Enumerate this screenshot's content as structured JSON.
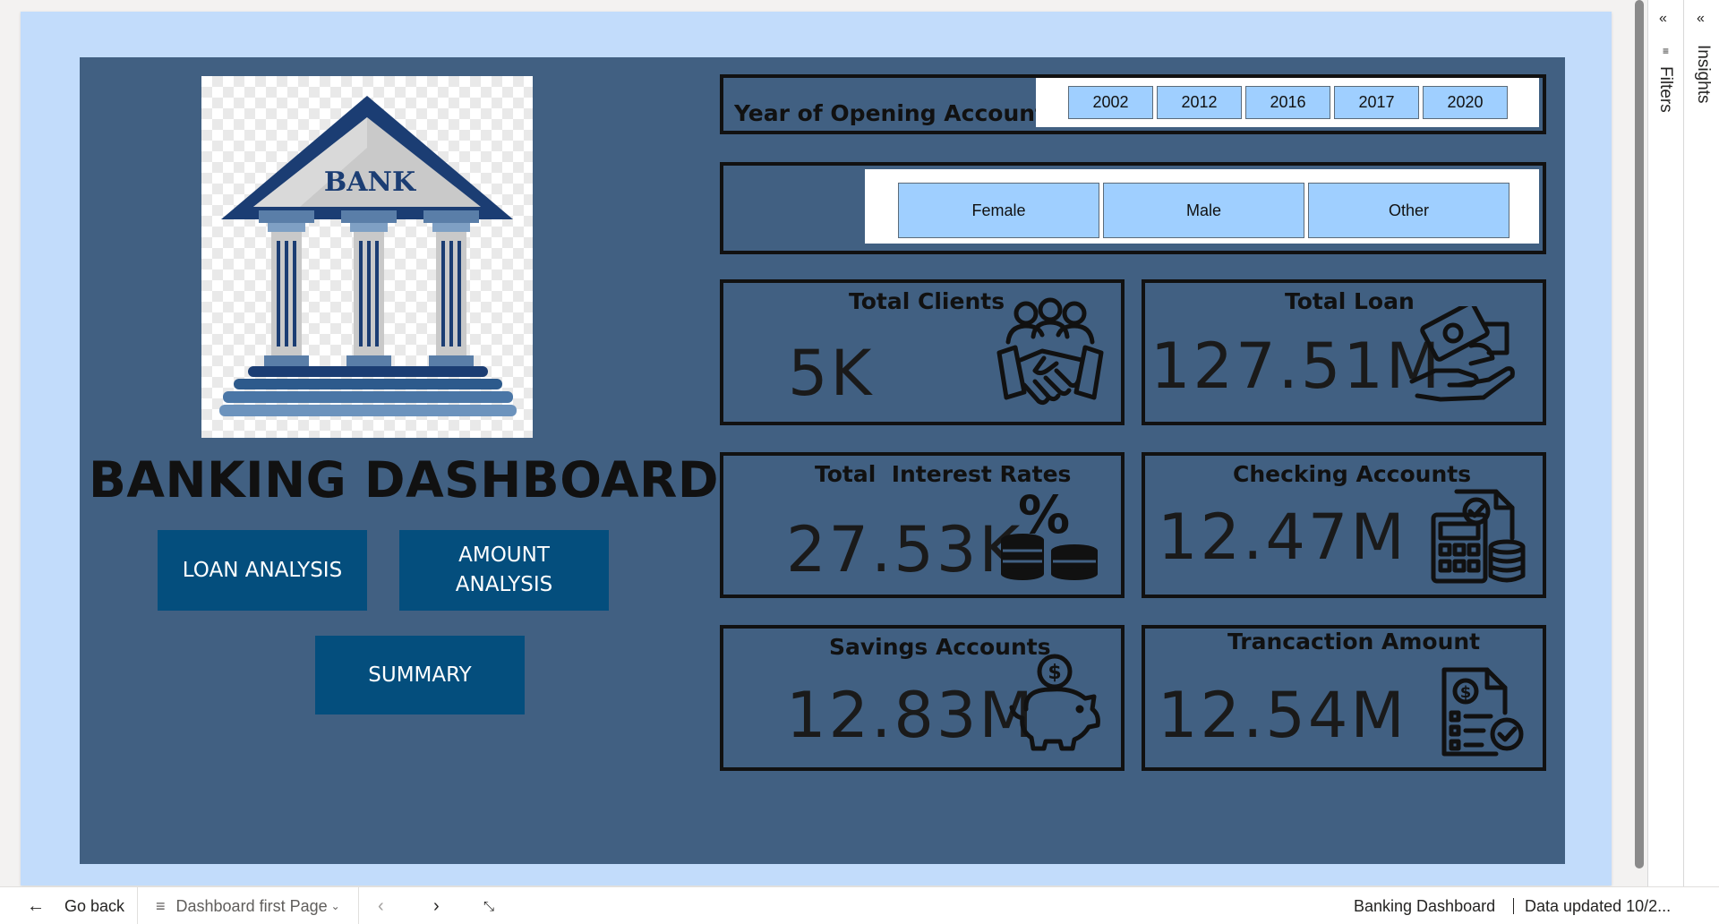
{
  "dashboard": {
    "title": "BANKING DASHBOARD",
    "logo_text": "BANK",
    "nav": {
      "loan_analysis": "LOAN ANALYSIS",
      "amount_analysis_line1": "AMOUNT",
      "amount_analysis_line2": "ANALYSIS",
      "summary": "SUMMARY"
    },
    "year_slicer": {
      "label": "Year of Opening Account",
      "options": [
        "2002",
        "2012",
        "2016",
        "2017",
        "2020"
      ]
    },
    "gender_slicer": {
      "options": [
        "Female",
        "Male",
        "Other"
      ]
    },
    "kpis": {
      "total_clients": {
        "title": "Total Clients",
        "value": "5K",
        "icon": "handshake-people-icon"
      },
      "total_loan": {
        "title": "Total Loan",
        "value": "127.51M",
        "icon": "money-hand-icon"
      },
      "total_interest": {
        "title": "Total  Interest Rates",
        "value": "27.53K",
        "icon": "percent-coins-icon"
      },
      "checking_accounts": {
        "title": "Checking Accounts",
        "value": "12.47M",
        "icon": "calculator-document-icon"
      },
      "savings_accounts": {
        "title": "Savings Accounts",
        "value": "12.83M",
        "icon": "piggy-bank-icon"
      },
      "transaction_amount": {
        "title": "Trancaction Amount",
        "value": "12.54M",
        "icon": "invoice-check-icon"
      }
    },
    "colors": {
      "page_bg": "#c2dcfb",
      "panel_bg": "#416082",
      "button_bg": "#044e7d",
      "chip_bg": "#9fcfff",
      "logo_blue": "#1b3d73"
    }
  },
  "panes": {
    "filters_label": "Filters",
    "insights_label": "Insights"
  },
  "bottom_bar": {
    "go_back": "Go back",
    "page_name": "Dashboard first Page",
    "report_name": "Banking Dashboard",
    "data_updated": "Data updated 10/2..."
  }
}
